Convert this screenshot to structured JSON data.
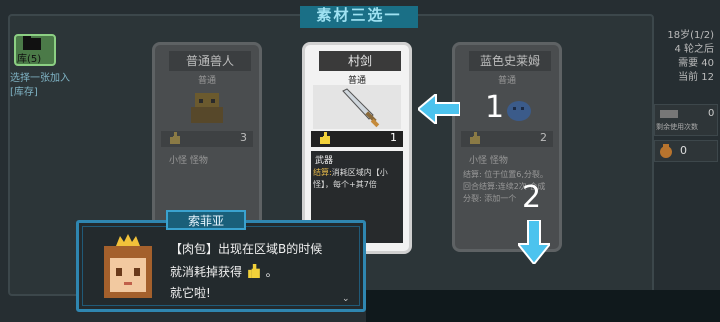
{
  "title": "素材三选一",
  "deck": {
    "label": "库(5)",
    "hint": "选择一张加入[库存]"
  },
  "cards": [
    {
      "name": "普通兽人",
      "rarity": "普通",
      "cost": "3",
      "tags": "小怪  怪物"
    },
    {
      "name": "村剑",
      "rarity": "普通",
      "cost": "1",
      "type": "武器",
      "desc_prefix": "结算:",
      "desc_body": "消耗区域内【小怪】，每个+其7倍",
      "icon": "sword-icon"
    },
    {
      "name": "蓝色史莱姆",
      "rarity": "普通",
      "cost": "2",
      "tags": "小怪  怪物",
      "desc_lines": [
        "结算: 位于位置6,分裂。",
        "回合结算:连续2次 合成",
        "分裂: 添加一个"
      ]
    }
  ],
  "right_panel": {
    "line1": "18岁(1/2)",
    "line2": "4 轮之后",
    "line3_label": "需要",
    "line3_value": "40",
    "line4_label": "当前",
    "line4_value": "12",
    "box1_label": "剩余使用次数",
    "box1_value": "0",
    "box2_value": "0"
  },
  "annotations": {
    "num1": "1",
    "num2": "2"
  },
  "dialog": {
    "speaker": "索菲亚",
    "line1": "【肉包】出现在区域B的时候",
    "line2": "就消耗掉获得",
    "line2_suffix": "。",
    "line3": "就它啦!",
    "more": "⌄"
  },
  "colors": {
    "accent": "#2f86b0",
    "highlight": "#e6b94a",
    "arrow": "#4cc3ee"
  }
}
